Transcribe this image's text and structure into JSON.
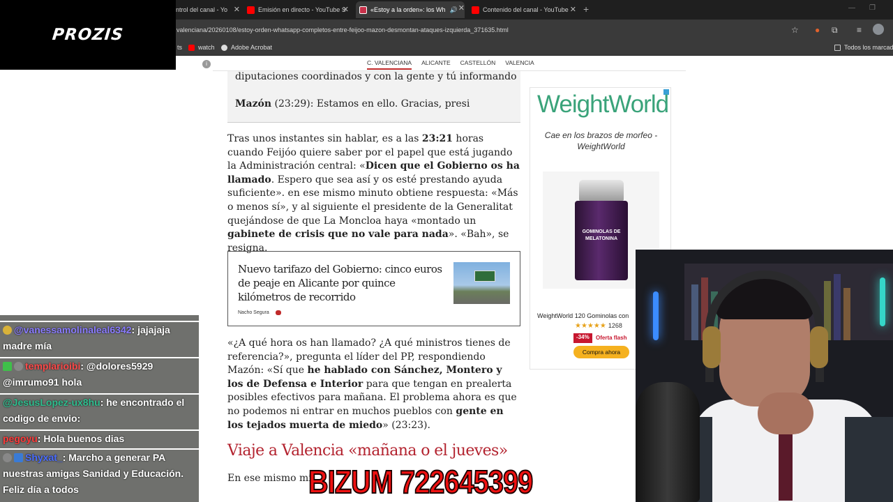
{
  "browser": {
    "tabs": [
      {
        "title": "ntrol del canal - Yo",
        "active": false
      },
      {
        "title": "Emisión en directo - YouTube S",
        "active": false
      },
      {
        "title": "«Estoy a la orden»: los Wh",
        "active": true
      },
      {
        "title": "Contenido del canal - YouTube",
        "active": false
      }
    ],
    "url": "valenciana/20260108/estoy-orden-whatsapp-completos-entre-feijoo-mazon-desmontan-ataques-izquierda_371635.html",
    "bookmarks": {
      "first": "ts",
      "watch": "watch",
      "acrobat": "Adobe Acrobat",
      "all": "Todos los marcado"
    }
  },
  "overlay": {
    "logo": "PROZIS",
    "bizum": "BIZUM 722645399"
  },
  "chat": {
    "messages": [
      {
        "user": "@vanessamolinaleal6342",
        "text": ": jajajaja madre mía",
        "user_color": "#8a7cff"
      },
      {
        "user": "templarioibi",
        "text": ": @dolores5929 @imrumo91 hola",
        "user_color": "#ff4a4a"
      },
      {
        "user": "@JesusLopez-ux8hu",
        "text": ": he encontrado el codigo de envio:",
        "user_color": "#2fbf8f"
      },
      {
        "user": "pegoyu",
        "text": ": Hola buenos dias",
        "user_color": "#ff3b3b"
      },
      {
        "user": "Shyxat_",
        "text": ": Marcho a generar PA nuestras amigas Sanidad y Educación. Feliz día a todos",
        "user_color": "#4a6dff"
      }
    ]
  },
  "site": {
    "nav": [
      "C. VALENCIANA",
      "ALICANTE",
      "CASTELLÓN",
      "VALENCIA"
    ],
    "quote_line1": "diputaciones coordinados y con la gente y tú informando",
    "quote_speaker": "Mazón",
    "quote_text": " (23:29): Estamos en ello. Gracias, presi",
    "para1": {
      "a": "Tras unos instantes sin hablar, es a las ",
      "b": "23:21",
      "c": " horas cuando Feijóo quiere saber por el papel que está jugando la Administración central: «",
      "d": "Dicen que el Gobierno os ha llamado",
      "e": ". Espero que sea así y os esté prestando ayuda suficiente». en ese mismo minuto obtiene respuesta: «Más o menos sí», y al siguiente el presidente de la Generalitat quejándose de que La Moncloa haya «montado un ",
      "f": "gabinete de crisis que no vale para nada",
      "g": "». «Bah», se resigna."
    },
    "related": {
      "title": "Nuevo tarifazo del Gobierno: cinco euros de peaje en Alicante por quince kilómetros de recorrido",
      "author": "Nacho Segura"
    },
    "para2": {
      "a": "«¿A qué hora os han llamado? ¿A qué ministros tienes de referencia?», pregunta el líder del PP, respondiendo Mazón: «Sí que ",
      "b": "he hablado con Sánchez, Montero y los de Defensa e Interior",
      "c": " para que tengan en prealerta posibles efectivos para mañana. El problema ahora es que no podemos ni entrar en muchos pueblos con ",
      "d": "gente en los tejados muerta de miedo",
      "e": "» (23:23)."
    },
    "heading": "Viaje a Valencia «mañana o el jueves»",
    "para3_start": "En ese mismo mi"
  },
  "ad": {
    "brand": "WeightWorld",
    "tagline": "Cae en los brazos de morfeo - WeightWorld",
    "product_label": "GOMINOLAS DE MELATONINA",
    "product_name": "WeightWorld 120 Gominolas con",
    "stars": "★★★★★",
    "rating_count": "1268",
    "discount": "-34%",
    "flash": "Oferta flash",
    "cta": "Compra ahora"
  },
  "colors": {
    "accent_red": "#c02a2a",
    "bizum_red": "#ee1111",
    "ad_green": "#3aa37a",
    "cta_yellow": "#f5b11f"
  }
}
